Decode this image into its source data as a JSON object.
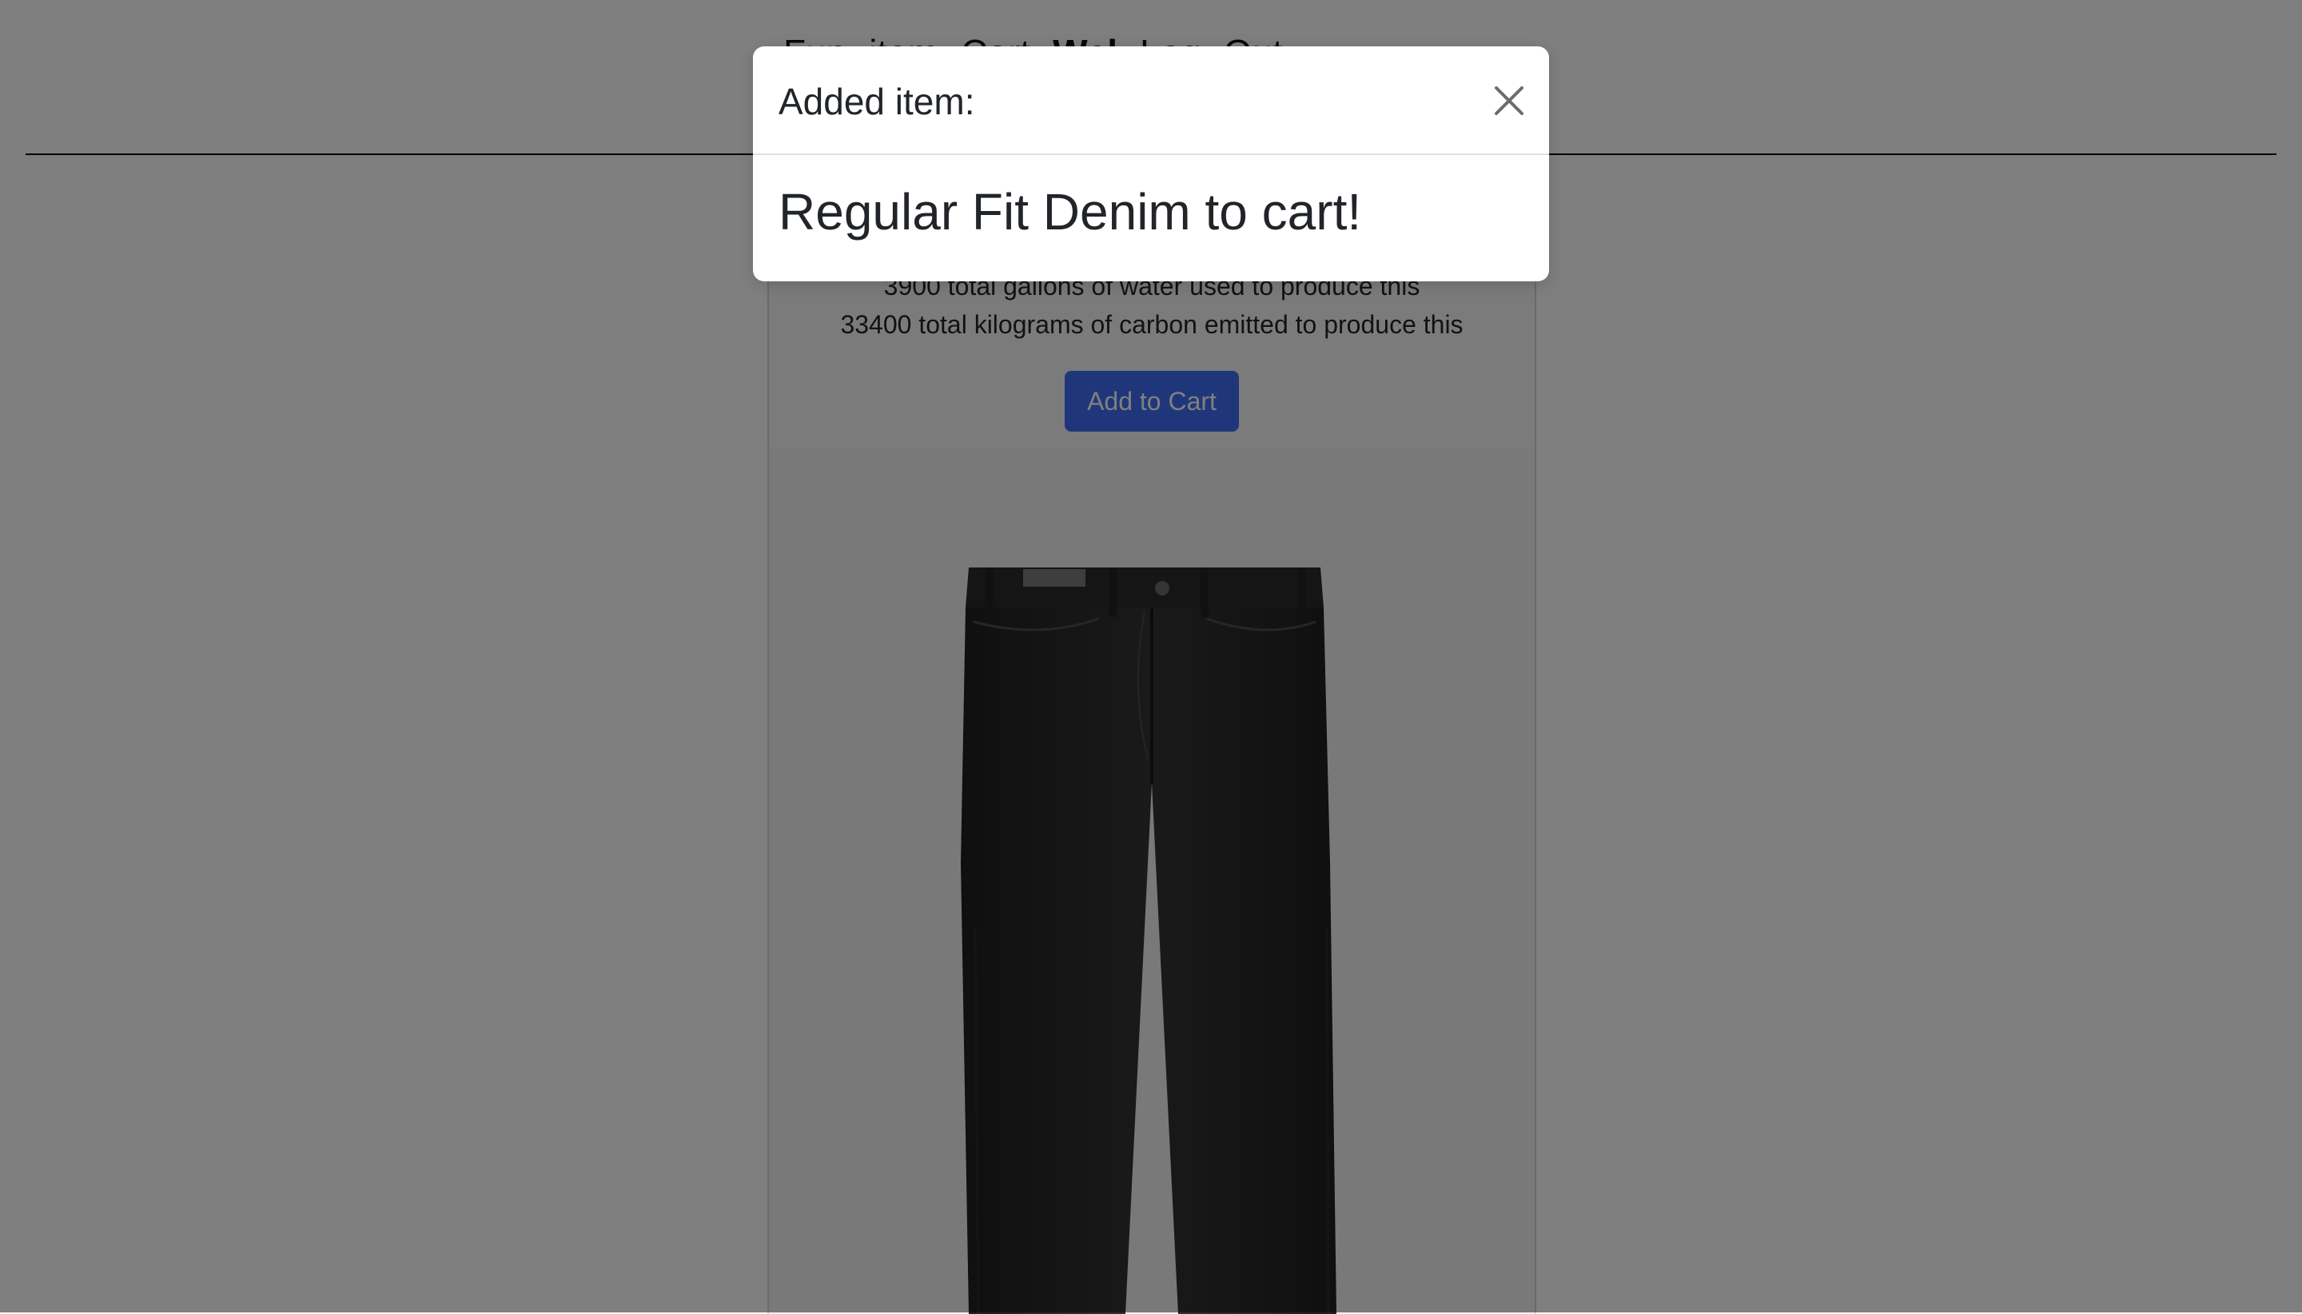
{
  "header": {
    "nav": [
      {
        "label": "Fun",
        "bold": false
      },
      {
        "label": "item",
        "bold": false
      },
      {
        "label": "Cart",
        "bold": false
      },
      {
        "label": "Wel",
        "bold": true
      },
      {
        "label": "Log",
        "bold": false
      },
      {
        "label": "Out",
        "bold": false
      }
    ]
  },
  "product": {
    "water_text": "3900 total gallons of water used to produce this",
    "carbon_text": "33400 total kilograms of carbon emitted to produce this",
    "add_to_cart_label": "Add to Cart",
    "image_alt": "black jeans"
  },
  "modal": {
    "title": "Added item:",
    "message": "Regular Fit Denim to cart!",
    "close_icon": "close-icon"
  },
  "colors": {
    "overlay": "rgba(0,0,0,0.5)",
    "button": "#3e6ef5",
    "denim": "#2b2b2d"
  }
}
